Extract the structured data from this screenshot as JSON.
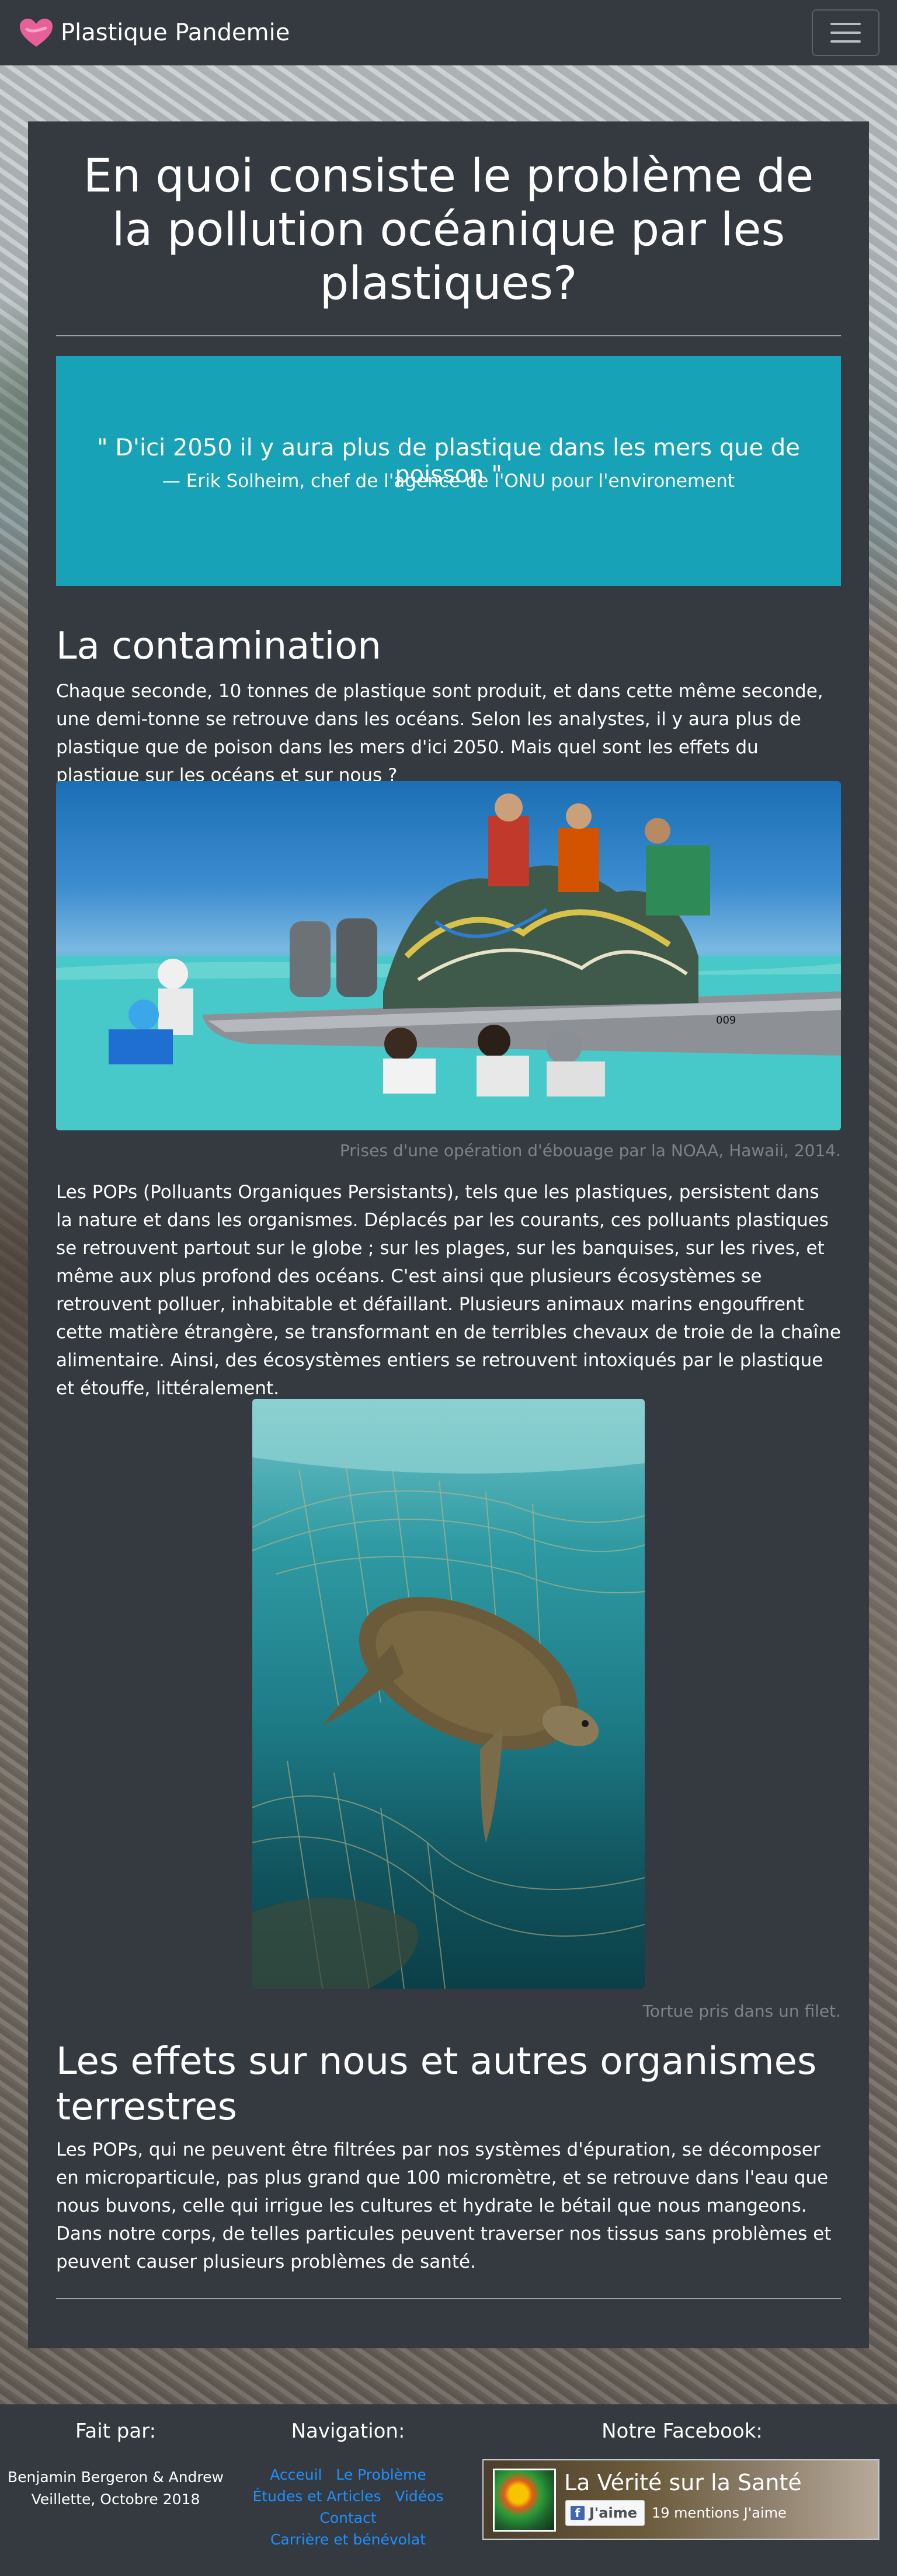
{
  "navbar": {
    "brand": "Plastique Pandemie",
    "toggle_icon": "hamburger-menu-icon"
  },
  "article": {
    "title": "En quoi consiste le problème de la pollution océanique par les plastiques?",
    "quote": {
      "text": "\" D'ici 2050 il y aura plus de plastique dans les mers que de poisson \"",
      "author": "— Erik Solheim, chef de l'agence de l'ONU pour l'environement"
    },
    "section1": {
      "heading": "La contamination",
      "intro": "Chaque seconde, 10 tonnes de plastique sont produit, et dans cette même seconde, une demi-tonne se retrouve dans les océans. Selon les analystes, il y aura plus de plastique que de poison dans les mers d'ici 2050. Mais quel sont les effets du plastique sur les océans et sur nous ?",
      "photo1_caption": "Prises d'une opération d'ébouage par la NOAA, Hawaii, 2014.",
      "body": "Les POPs (Polluants Organiques Persistants), tels que les plastiques, persistent dans la nature et dans les organismes. Déplacés par les courants, ces polluants plastiques se retrouvent partout sur le globe ; sur les plages, sur les banquises, sur les rives, et même aux plus profond des océans. C'est ainsi que plusieurs écosystèmes se retrouvent polluer, inhabitable et défaillant. Plusieurs animaux marins engouffrent cette matière étrangère, se transformant en de terribles chevaux de troie de la chaîne alimentaire. Ainsi, des écosystèmes entiers se retrouvent intoxiqués par le plastique et étouffe, littéralement.",
      "photo2_caption": "Tortue pris dans un filet."
    },
    "section2": {
      "heading": "Les effets sur nous et autres organismes terrestres",
      "body": "Les POPs, qui ne peuvent être filtrées par nos systèmes d'épuration, se décomposer en microparticule, pas plus grand que 100 micromètre, et se retrouve dans l'eau que nous buvons, celle qui irrigue les cultures et hydrate le bétail que nous mangeons. Dans notre corps, de telles particules peuvent traverser nos tissus sans problèmes et peuvent causer plusieurs problèmes de santé."
    }
  },
  "footer": {
    "credits_heading": "Fait par:",
    "credits_line1": "Benjamin Bergeron & Andrew",
    "credits_line2": "Veillette, Octobre 2018",
    "nav_heading": "Navigation:",
    "nav_links": [
      "Acceuil",
      "Le Problème",
      "Études et Articles",
      "Vidéos",
      "Contact",
      "Carrière et bénévolat"
    ],
    "facebook_heading": "Notre Facebook:",
    "facebook": {
      "page_name": "La Vérité sur la Santé",
      "like_label": "J'aime",
      "like_count": "19 mentions J'aime"
    }
  },
  "colors": {
    "navbar": "#343a40",
    "card": "#343a40",
    "quote_box": "#17a2b8",
    "link": "#1e90ff",
    "caption": "#7e8389"
  }
}
